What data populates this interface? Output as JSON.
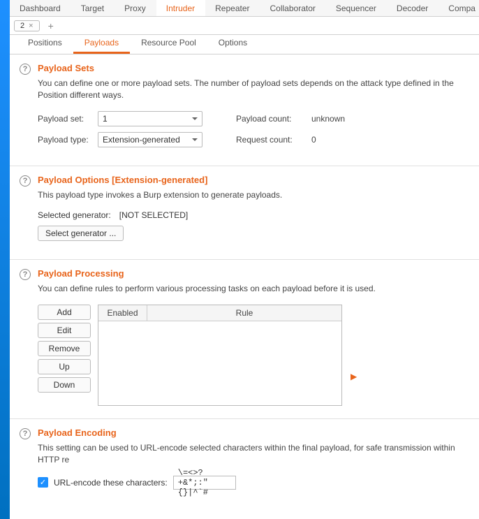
{
  "top_tabs": {
    "dashboard": "Dashboard",
    "target": "Target",
    "proxy": "Proxy",
    "intruder": "Intruder",
    "repeater": "Repeater",
    "collaborator": "Collaborator",
    "sequencer": "Sequencer",
    "decoder": "Decoder",
    "comparer": "Compa"
  },
  "sub_tab": {
    "label": "2",
    "close": "×",
    "add": "+"
  },
  "inner_tabs": {
    "positions": "Positions",
    "payloads": "Payloads",
    "resource_pool": "Resource Pool",
    "options": "Options"
  },
  "help_glyph": "?",
  "payload_sets": {
    "title": "Payload Sets",
    "desc": "You can define one or more payload sets. The number of payload sets depends on the attack type defined in the Position different ways.",
    "set_label": "Payload set:",
    "set_value": "1",
    "type_label": "Payload type:",
    "type_value": "Extension-generated",
    "pcount_label": "Payload count:",
    "pcount_value": "unknown",
    "rcount_label": "Request count:",
    "rcount_value": "0"
  },
  "payload_options": {
    "title": "Payload Options [Extension-generated]",
    "desc": "This payload type invokes a Burp extension to generate payloads.",
    "sel_label": "Selected generator:",
    "sel_value": "[NOT SELECTED]",
    "btn": "Select generator ..."
  },
  "payload_processing": {
    "title": "Payload Processing",
    "desc": "You can define rules to perform various processing tasks on each payload before it is used.",
    "btn_add": "Add",
    "btn_edit": "Edit",
    "btn_remove": "Remove",
    "btn_up": "Up",
    "btn_down": "Down",
    "col_enabled": "Enabled",
    "col_rule": "Rule",
    "arrow": "▶"
  },
  "payload_encoding": {
    "title": "Payload Encoding",
    "desc": "This setting can be used to URL-encode selected characters within the final payload, for safe transmission within HTTP re",
    "check_glyph": "✓",
    "check_label": "URL-encode these characters:",
    "input_value": "\\=<>?+&*;:\"{}|^`#"
  }
}
